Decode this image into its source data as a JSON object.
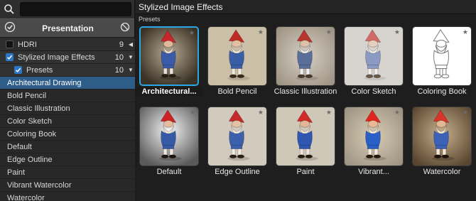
{
  "sidebar": {
    "presentation_label": "Presentation",
    "rows": [
      {
        "label": "HDRI",
        "count": "9",
        "arrow": "◀",
        "checked": false
      },
      {
        "label": "Stylized Image Effects",
        "count": "10",
        "arrow": "▼",
        "checked": true
      },
      {
        "label": "Presets",
        "count": "10",
        "arrow": "▼",
        "checked": true
      }
    ],
    "presets": [
      "Architectural Drawing",
      "Bold Pencil",
      "Classic Illustration",
      "Color Sketch",
      "Coloring Book",
      "Default",
      "Edge Outline",
      "Paint",
      "Vibrant Watercolor",
      "Watercolor"
    ]
  },
  "main": {
    "title": "Stylized Image Effects",
    "section_label": "Presets",
    "thumbnails": [
      {
        "caption": "Architectural...",
        "bg": "#5a5040",
        "style": "dark"
      },
      {
        "caption": "Bold Pencil",
        "bg": "#cbbfa8",
        "style": "pencil"
      },
      {
        "caption": "Classic Illustration",
        "bg": "#d6cfc4",
        "style": "illus"
      },
      {
        "caption": "Color Sketch",
        "bg": "#d7d4cf",
        "style": "sketch"
      },
      {
        "caption": "Coloring Book",
        "bg": "#ffffff",
        "style": "book"
      },
      {
        "caption": "Default",
        "bg": "#b0b0b0",
        "style": "default"
      },
      {
        "caption": "Edge Outline",
        "bg": "#d2cbbd",
        "style": "edge"
      },
      {
        "caption": "Paint",
        "bg": "#cfc7b8",
        "style": "paint"
      },
      {
        "caption": "Vibrant...",
        "bg": "#d8ccb4",
        "style": "vibrant"
      },
      {
        "caption": "Watercolor",
        "bg": "#8a7458",
        "style": "water"
      }
    ]
  },
  "icons": {
    "search": "search-icon",
    "check_circle": "check-circle-icon",
    "no": "prohibit-icon",
    "star": "star-icon",
    "check": "check-icon"
  },
  "colors": {
    "accent": "#2aa7e6",
    "selected_row": "#2f5d8a",
    "checkbox": "#2c78c6"
  }
}
